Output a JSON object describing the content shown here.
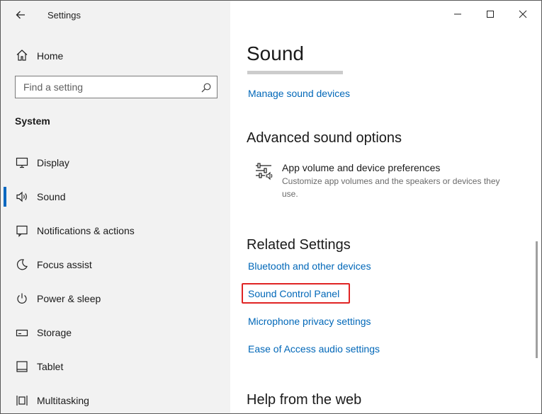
{
  "window": {
    "app_title": "Settings",
    "controls": [
      "minimize-icon",
      "maximize-icon",
      "close-icon"
    ]
  },
  "sidebar": {
    "home_label": "Home",
    "search_placeholder": "Find a setting",
    "section": "System",
    "items": [
      {
        "label": "Display",
        "icon": "display-icon",
        "active": false
      },
      {
        "label": "Sound",
        "icon": "speaker-icon",
        "active": true
      },
      {
        "label": "Notifications & actions",
        "icon": "notifications-icon",
        "active": false
      },
      {
        "label": "Focus assist",
        "icon": "moon-icon",
        "active": false
      },
      {
        "label": "Power & sleep",
        "icon": "power-icon",
        "active": false
      },
      {
        "label": "Storage",
        "icon": "storage-icon",
        "active": false
      },
      {
        "label": "Tablet",
        "icon": "tablet-icon",
        "active": false
      },
      {
        "label": "Multitasking",
        "icon": "multitasking-icon",
        "active": false
      }
    ]
  },
  "main": {
    "title": "Sound",
    "manage_link": "Manage sound devices",
    "advanced": {
      "heading": "Advanced sound options",
      "item_title": "App volume and device preferences",
      "item_desc": "Customize app volumes and the speakers or devices they use."
    },
    "related": {
      "heading": "Related Settings",
      "links": [
        "Bluetooth and other devices",
        "Sound Control Panel",
        "Microphone privacy settings",
        "Ease of Access audio settings"
      ]
    },
    "help_heading": "Help from the web"
  },
  "colors": {
    "accent": "#0067b8",
    "sidebar_bg": "#f2f2f2",
    "highlight": "#e02424"
  }
}
